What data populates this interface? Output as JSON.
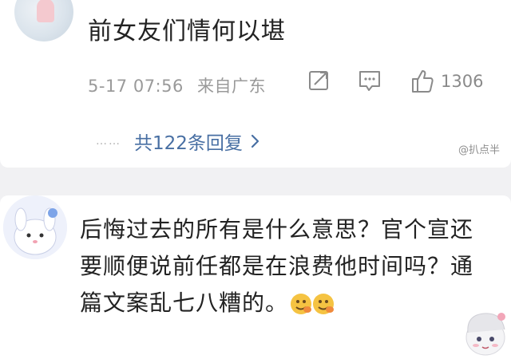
{
  "comment1": {
    "text": "前女友们情何以堪",
    "date": "5-17 07:56",
    "location": "来自广东",
    "like_count": "1306",
    "replies_dots": "……",
    "replies_label": "共122条回复",
    "watermark": "@扒点半"
  },
  "comment2": {
    "text": "后悔过去的所有是什么意思？官个宣还要顺便说前任都是在浪费他时间吗？通篇文案乱七八糟的。"
  },
  "colors": {
    "link": "#486fa3",
    "meta": "#9a9a9a",
    "background": "#f1f1f3"
  },
  "icons": [
    "share-icon",
    "comment-icon",
    "thumbs-up-icon",
    "chevron-right-icon",
    "emoji-icon"
  ]
}
